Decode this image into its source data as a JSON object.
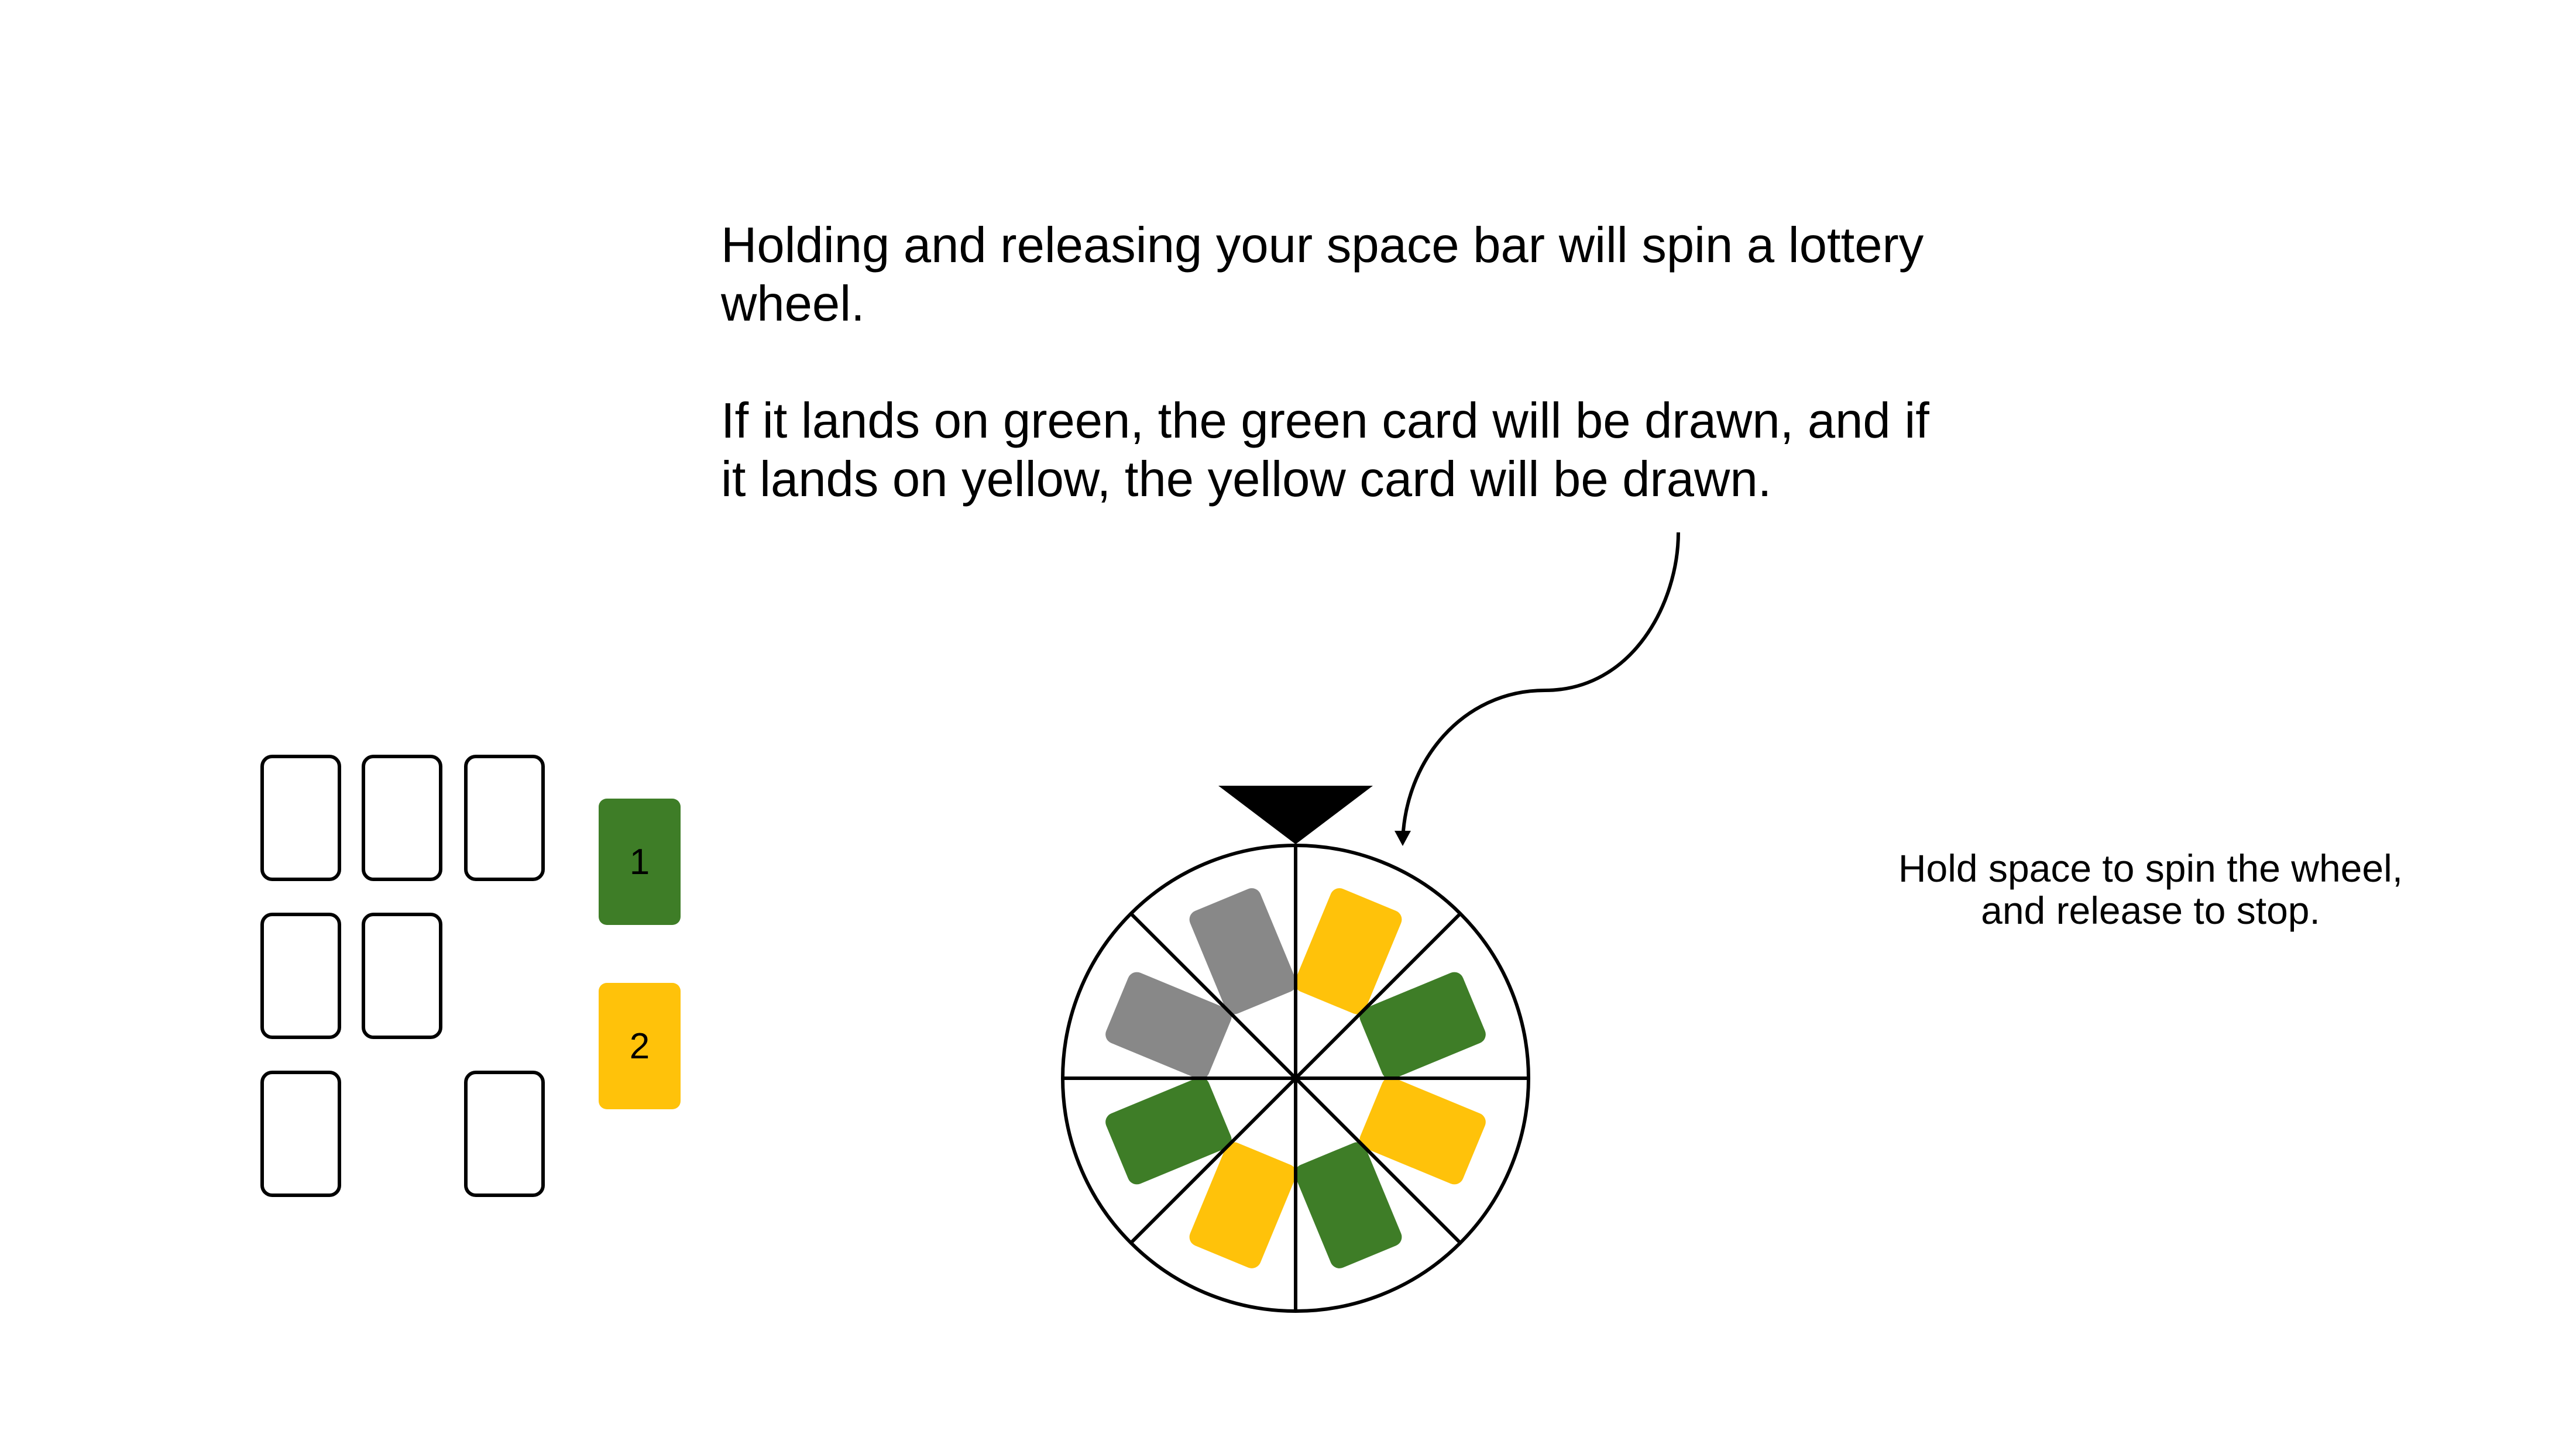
{
  "instructions": {
    "paragraph_1": "Holding and releasing your space bar will spin a lottery wheel.",
    "paragraph_2": "If it lands on green, the green card will be drawn, and if it lands on yellow, the yellow card will be drawn."
  },
  "hint": {
    "line_1": "Hold space to spin the wheel,",
    "line_2": "and release to stop."
  },
  "legend": [
    {
      "label": "1",
      "color": "#3e7d27"
    },
    {
      "label": "2",
      "color": "#ffc20a"
    }
  ],
  "colors": {
    "green": "#3e7d27",
    "yellow": "#ffc20a",
    "gray": "#888888"
  },
  "wheel": {
    "sector_colors_clockwise_from_top": [
      "yellow",
      "green",
      "yellow",
      "green",
      "yellow",
      "green",
      "gray",
      "gray"
    ]
  }
}
